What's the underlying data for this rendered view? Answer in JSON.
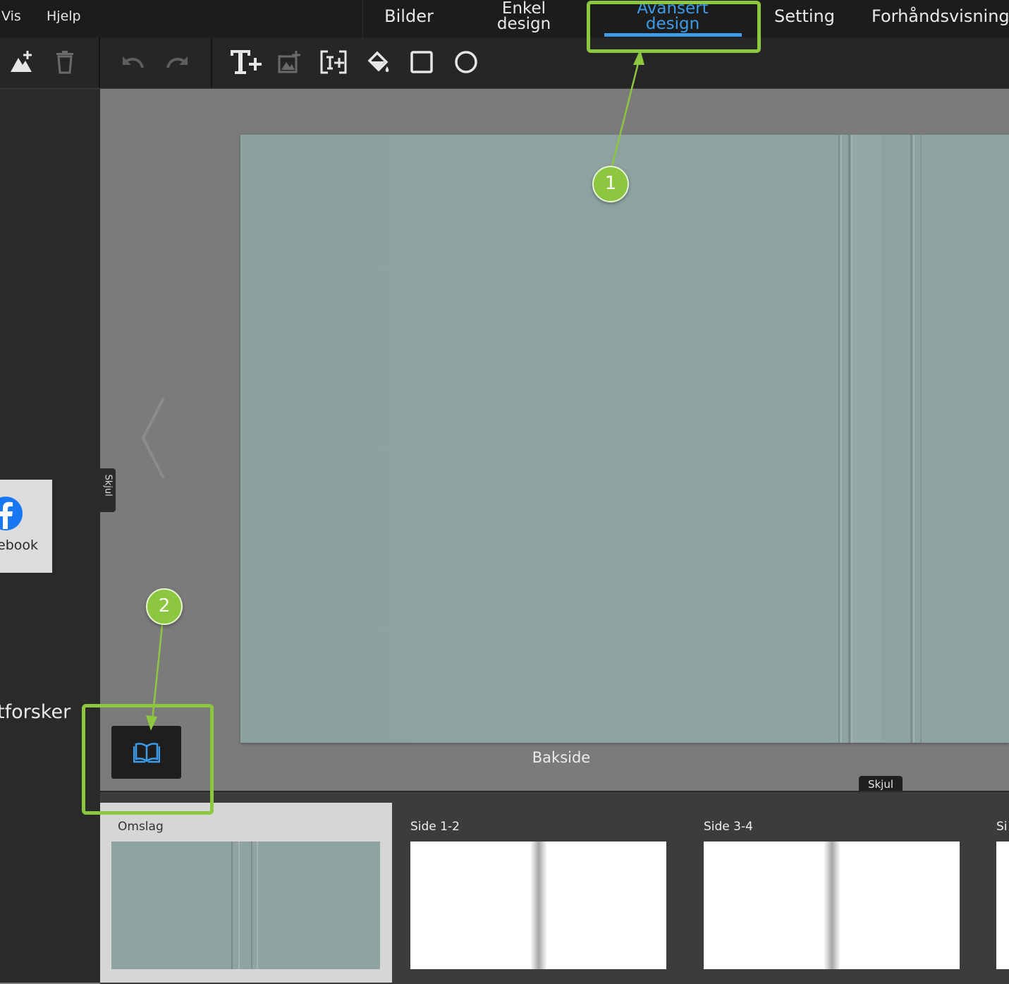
{
  "menu": {
    "view": "Vis",
    "help": "Hjelp"
  },
  "nav_tabs": [
    {
      "line1": "Bilder"
    },
    {
      "line1": "Enkel",
      "line2": "design"
    },
    {
      "line1": "Avansert",
      "line2": "design",
      "active": true
    },
    {
      "line1": "Setting"
    },
    {
      "line1": "Forhåndsvisning"
    }
  ],
  "toolbar": {
    "icons": [
      "add-image-icon",
      "trash-icon",
      "undo-icon",
      "redo-icon",
      "add-text-icon",
      "add-photo-frame-icon",
      "add-text-frame-icon",
      "fill-bucket-icon",
      "rectangle-icon",
      "circle-icon"
    ]
  },
  "sidebar": {
    "facebook_label": "ebook",
    "explorer_label": "tforsker",
    "hide_label": "Skjul"
  },
  "canvas": {
    "page_label": "Bakside",
    "hide_label": "Skjul"
  },
  "filmstrip": {
    "pages": [
      {
        "label": "Omslag",
        "selected": true
      },
      {
        "label": "Side 1-2"
      },
      {
        "label": "Side 3-4"
      },
      {
        "label": "Si"
      }
    ]
  },
  "annotations": [
    {
      "number": "1",
      "target": "Avansert design tab"
    },
    {
      "number": "2",
      "target": "pages view button"
    }
  ],
  "colors": {
    "accent": "#3d9be9",
    "callout": "#8dc63f",
    "cover": "#8fa4a2",
    "menubar": "#1c1c1c",
    "toolbar": "#262626"
  }
}
